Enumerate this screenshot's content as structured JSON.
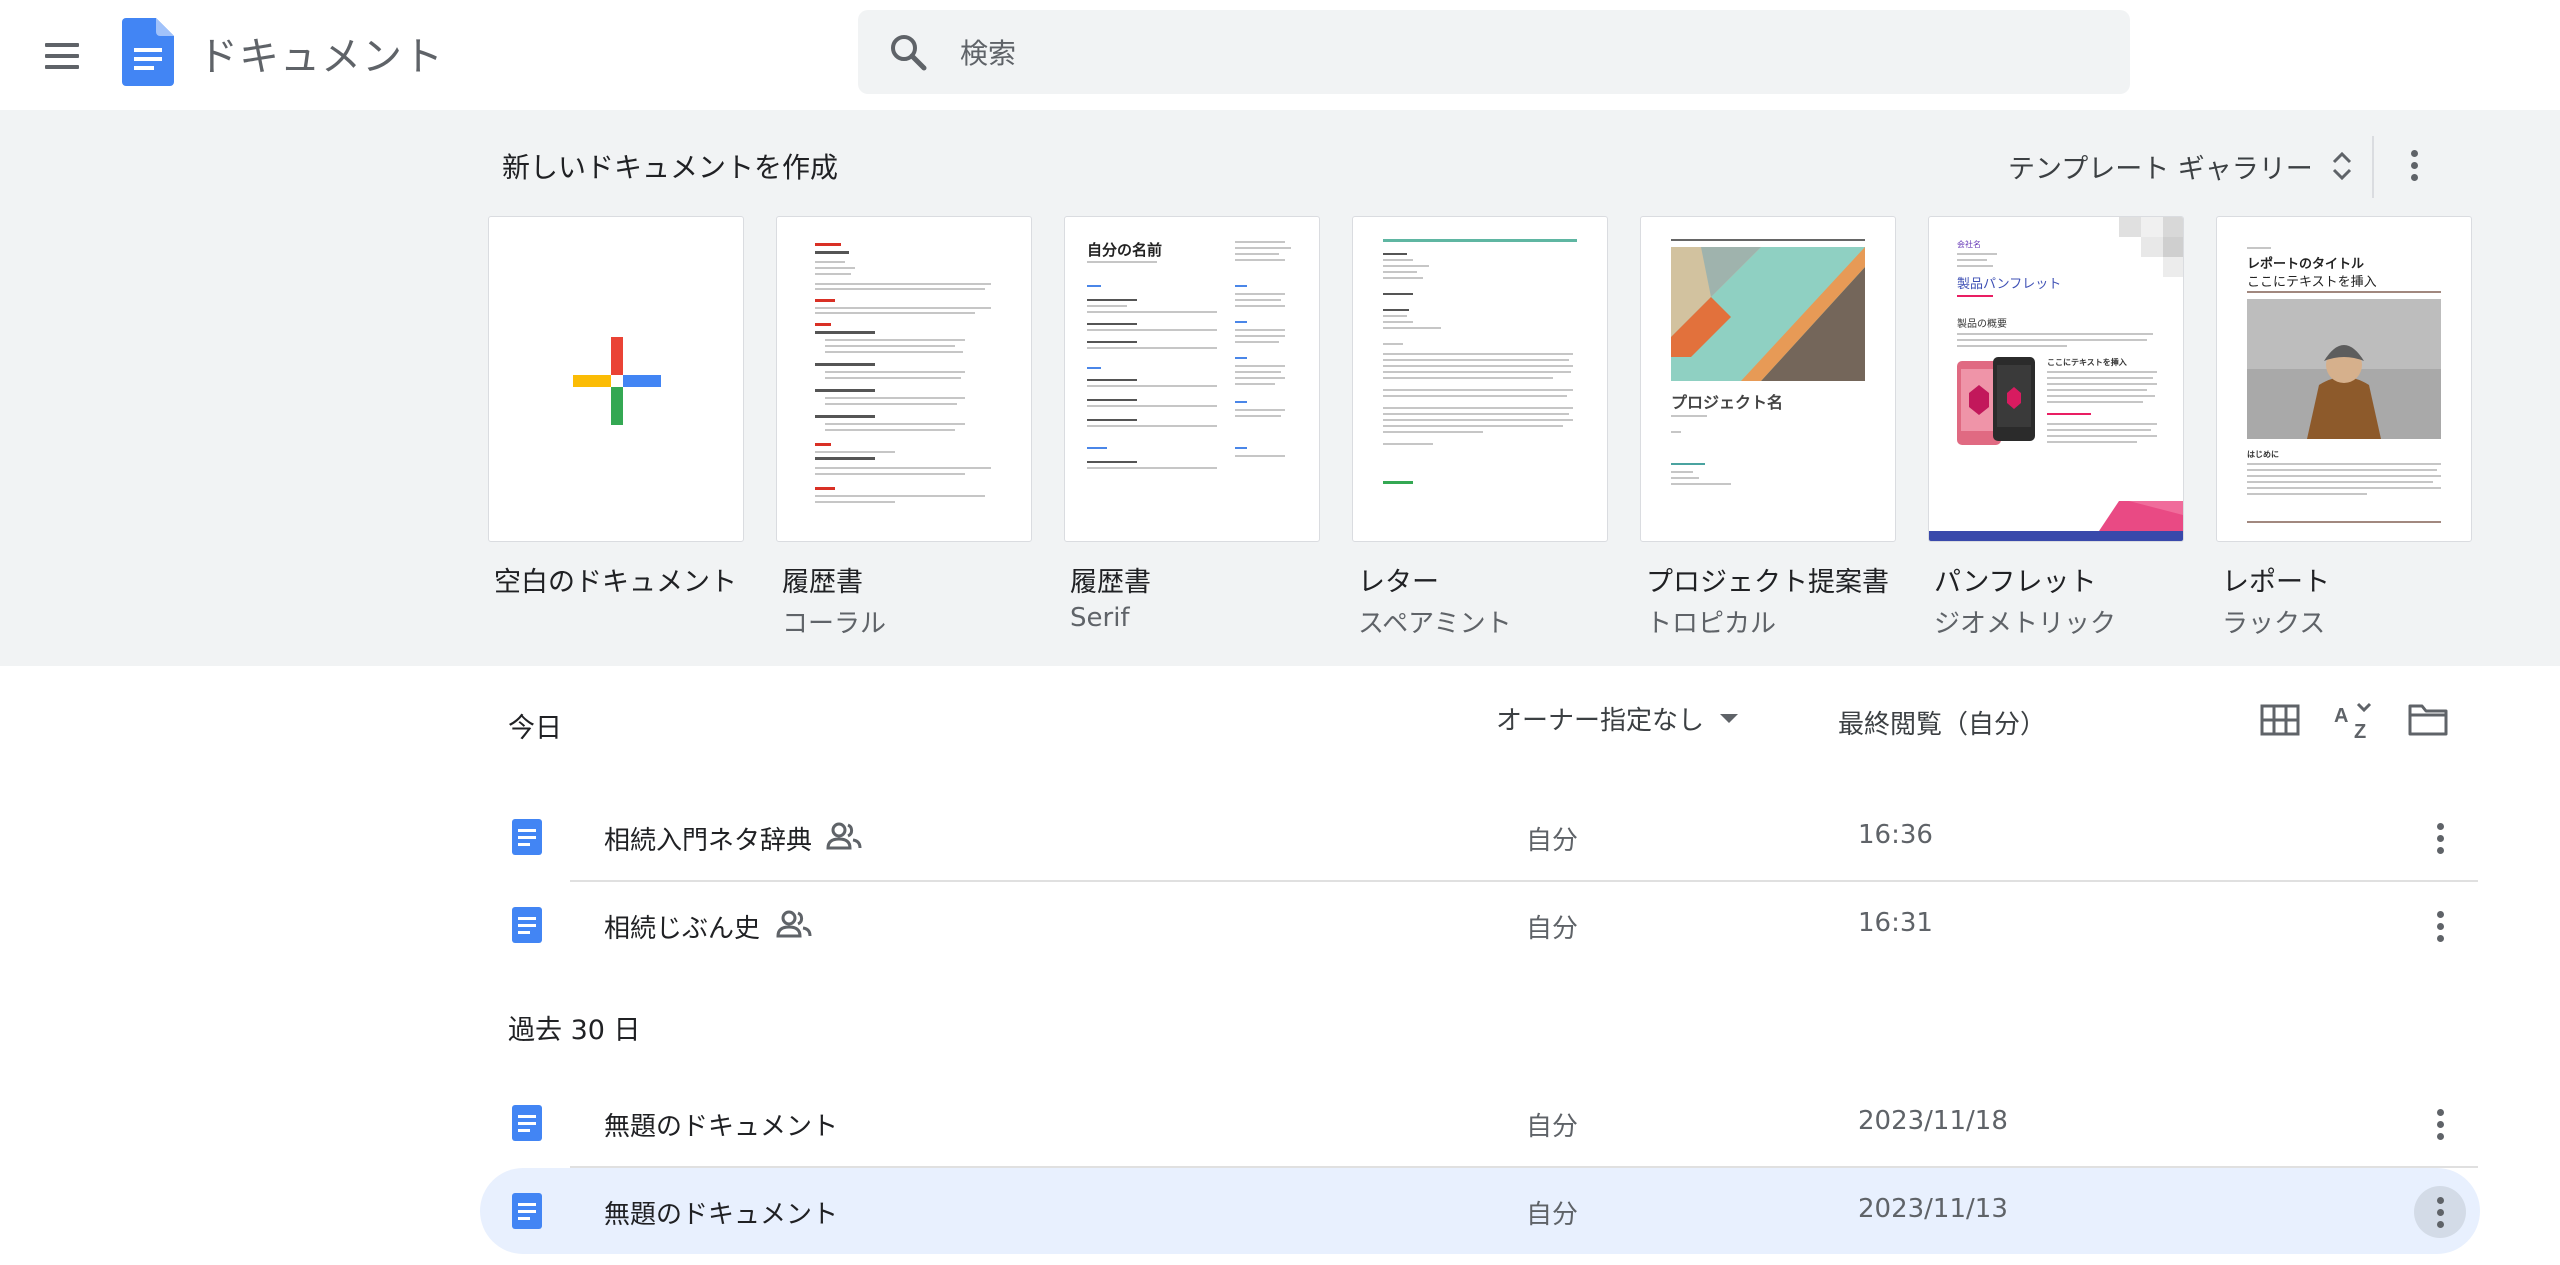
{
  "header": {
    "app_title": "ドキュメント",
    "search_placeholder": "検索"
  },
  "templates": {
    "title": "新しいドキュメントを作成",
    "gallery_label": "テンプレート ギャラリー",
    "items": [
      {
        "name": "空白のドキュメント",
        "sub": ""
      },
      {
        "name": "履歴書",
        "sub": "コーラル"
      },
      {
        "name": "履歴書",
        "sub": "Serif"
      },
      {
        "name": "レター",
        "sub": "スペアミント"
      },
      {
        "name": "プロジェクト提案書",
        "sub": "トロピカル"
      },
      {
        "name": "パンフレット",
        "sub": "ジオメトリック"
      },
      {
        "name": "レポート",
        "sub": "ラックス"
      }
    ],
    "thumb_text": {
      "serif_name": "自分の名前",
      "project_name": "プロジェクト名",
      "brochure_company": "会社名",
      "brochure_title": "製品パンフレット",
      "brochure_overview": "製品の概要",
      "brochure_insert": "ここにテキストを挿入",
      "report_title": "レポートのタイトル",
      "report_subtitle": "ここにテキストを挿入",
      "report_intro": "はじめに"
    }
  },
  "list": {
    "section_today": "今日",
    "section_past": "過去 30 日",
    "owner_filter": "オーナー指定なし",
    "sort_label": "最終閲覧（自分）",
    "rows": [
      {
        "name": "相続入門ネタ辞典",
        "owner": "自分",
        "date": "16:36",
        "shared": true
      },
      {
        "name": "相続じぶん史",
        "owner": "自分",
        "date": "16:31",
        "shared": true
      },
      {
        "name": "無題のドキュメント",
        "owner": "自分",
        "date": "2023/11/18",
        "shared": false
      },
      {
        "name": "無題のドキュメント",
        "owner": "自分",
        "date": "2023/11/13",
        "shared": false
      }
    ]
  },
  "colors": {
    "docs_blue": "#4285f4",
    "highlight": "#e8f0fe",
    "panel_bg": "#f1f3f4"
  }
}
